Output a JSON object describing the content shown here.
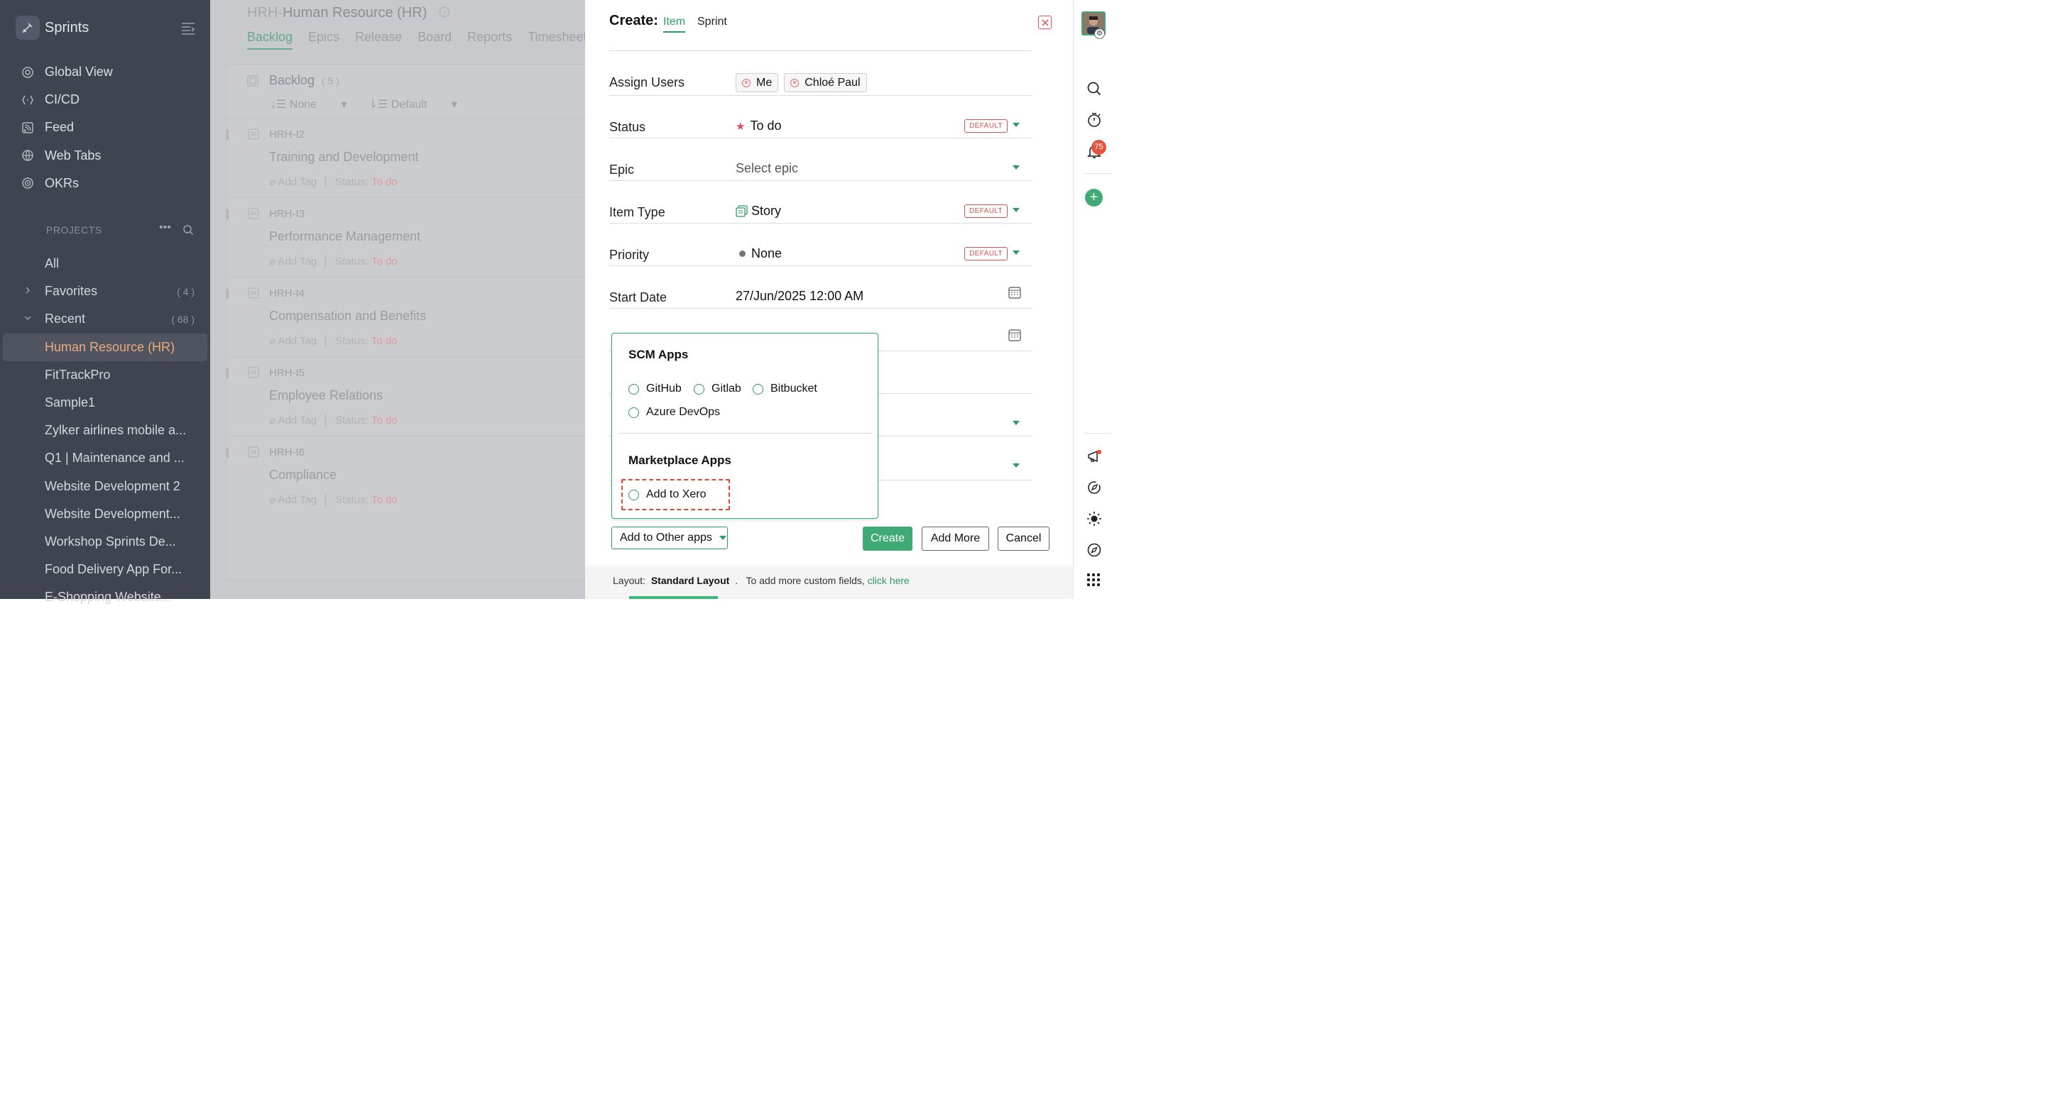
{
  "sidebar": {
    "brand": "Sprints",
    "nav": [
      {
        "label": "Global View",
        "icon": "global-view-icon"
      },
      {
        "label": "CI/CD",
        "icon": "cicd-icon"
      },
      {
        "label": "Feed",
        "icon": "feed-icon"
      },
      {
        "label": "Web Tabs",
        "icon": "web-tabs-icon"
      },
      {
        "label": "OKRs",
        "icon": "okrs-icon"
      }
    ],
    "projects_heading": "PROJECTS",
    "rows": [
      {
        "label": "All"
      },
      {
        "label": "Favorites",
        "count": "( 4 )"
      },
      {
        "label": "Recent",
        "count": "( 68 )"
      },
      {
        "label": "Human Resource (HR)"
      },
      {
        "label": "FitTrackPro"
      },
      {
        "label": "Sample1"
      },
      {
        "label": "Zylker airlines mobile a..."
      },
      {
        "label": "Q1 | Maintenance and ..."
      },
      {
        "label": "Website Development 2"
      },
      {
        "label": "Website Development..."
      },
      {
        "label": "Workshop Sprints De..."
      },
      {
        "label": "Food Delivery App For..."
      },
      {
        "label": "E-Shopping Website..."
      }
    ]
  },
  "main": {
    "project_prefix": "HRH-",
    "project_name": "Human Resource (HR)",
    "tabs": [
      "Backlog",
      "Epics",
      "Release",
      "Board",
      "Reports",
      "Timesheet"
    ],
    "backlog_title": "Backlog",
    "backlog_count": "( 5 )",
    "sort_none": "None",
    "sort_default": "Default",
    "add_tag": "Add Tag",
    "status_label": "Status:",
    "items": [
      {
        "key": "HRH-I2",
        "name": "Training and Development",
        "status": "To do"
      },
      {
        "key": "HRH-I3",
        "name": "Performance Management",
        "status": "To do"
      },
      {
        "key": "HRH-I4",
        "name": "Compensation and Benefits",
        "status": "To do"
      },
      {
        "key": "HRH-I5",
        "name": "Employee Relations",
        "status": "To do"
      },
      {
        "key": "HRH-I6",
        "name": "Compliance",
        "status": "To do"
      }
    ]
  },
  "form": {
    "title": "Create:",
    "tab_item": "Item",
    "tab_sprint": "Sprint",
    "assign_label": "Assign Users",
    "assignees": [
      "Me",
      "Chloé Paul"
    ],
    "status_label": "Status",
    "status_value": "To do",
    "epic_label": "Epic",
    "epic_placeholder": "Select epic",
    "type_label": "Item Type",
    "type_value": "Story",
    "priority_label": "Priority",
    "priority_value": "None",
    "start_label": "Start Date",
    "start_value": "27/Jun/2025 12:00 AM",
    "default_badge": "DEFAULT",
    "other_apps_button": "Add to Other apps",
    "create_button": "Create",
    "add_more_button": "Add More",
    "cancel_button": "Cancel",
    "footer_layout_label": "Layout:",
    "footer_layout_value": "Standard Layout",
    "footer_dot": ".",
    "footer_text": "To add more custom fields,",
    "footer_link": "click here"
  },
  "popup": {
    "scm_heading": "SCM Apps",
    "scm_options": [
      "GitHub",
      "Gitlab",
      "Bitbucket",
      "Azure DevOps"
    ],
    "market_heading": "Marketplace Apps",
    "market_options": [
      "Add to Xero"
    ]
  },
  "rail": {
    "notification_count": "75"
  },
  "colors": {
    "accent": "#3faa73",
    "danger": "#d9534f",
    "sidebar_bg": "#3f4450"
  }
}
